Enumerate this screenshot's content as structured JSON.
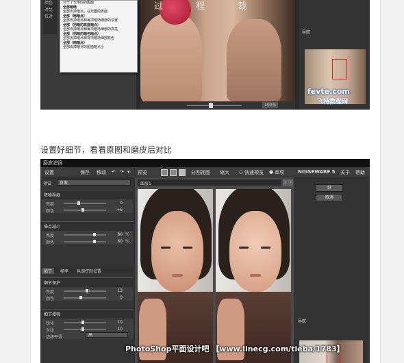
{
  "caption": "设置好细节，看看原图和磨皮后对比",
  "shot1": {
    "left_tabs": [
      "颜色",
      "对比",
      "仅对"
    ],
    "context_menu": [
      {
        "text": "对于了大维向的图面",
        "bold": false
      },
      {
        "text": "全部暗暗",
        "bold": true
      },
      {
        "text": "全部去掉暗点，在光圈的表面",
        "bold": false
      },
      {
        "text": "全部（暗暗点）",
        "bold": true
      },
      {
        "text": "全部去掉暗点和每项暗场细部的设置",
        "bold": false
      },
      {
        "text": "全部（把暗的高度暗点）",
        "bold": true
      },
      {
        "text": "全部去掉暗点和每项暗场细部的高亮",
        "bold": false
      },
      {
        "text": "全部（把暗的暗色暗点）",
        "bold": true
      },
      {
        "text": "全部去掉暗点和有项暗场细部颜色",
        "bold": false
      },
      {
        "text": "全部（暗暗点）",
        "bold": true
      },
      {
        "text": "全部去掉暗点的图面暗点小",
        "bold": false
      }
    ],
    "photo_watermark": "过 程 裁",
    "zoom_value": "100%",
    "nav_label": "导航",
    "logo_text": "fevte.com",
    "logo_sub": "飞特教程网"
  },
  "shot2": {
    "title": "磨皮滤镜",
    "left_toolbar": {
      "settings": "设置",
      "save": "保存",
      "delete": "移动"
    },
    "mid_toolbar": {
      "preview": "预览",
      "split_label": "分割视图",
      "zoom": "缩大",
      "fast_preview": "快速预览",
      "single": "单项"
    },
    "right_toolbar": {
      "brand": "NOISEWARE 5",
      "about": "关于",
      "help": "帮助"
    },
    "preset_label": "预设",
    "preset_value": "肖像",
    "sections": [
      {
        "header": "降噪程度",
        "rows": [
          {
            "label": "亮度",
            "value": "0",
            "unit": "",
            "pos": 0.35
          },
          {
            "label": "颜色",
            "value": "+6",
            "unit": "",
            "pos": 0.45
          }
        ]
      },
      {
        "header": "噪点减少",
        "rows": [
          {
            "label": "亮度",
            "value": "80",
            "unit": "%",
            "pos": 0.72
          },
          {
            "label": "颜色",
            "value": "80",
            "unit": "%",
            "pos": 0.72
          }
        ]
      }
    ],
    "tabs": [
      "细节",
      "频率",
      "色调控制设置"
    ],
    "detail_sections": [
      {
        "header": "细节保护",
        "rows": [
          {
            "label": "亮度",
            "value": "13",
            "unit": "",
            "pos": 0.55
          },
          {
            "label": "颜色",
            "value": "0",
            "unit": "",
            "pos": 0.4
          }
        ]
      },
      {
        "header": "细节增强",
        "rows": [
          {
            "label": "锐化",
            "value": "10",
            "unit": "",
            "pos": 0.45
          },
          {
            "label": "对比",
            "value": "10",
            "unit": "",
            "pos": 0.45
          }
        ]
      }
    ],
    "edge_label": "边缘平滑",
    "edge_value": "高",
    "path_label": "图层1",
    "right_buttons": [
      "好",
      "取消"
    ],
    "nav_label": "导航",
    "watermark": "PhotoShop平面设计吧 【www.linecg.com/tieba/1783】"
  }
}
